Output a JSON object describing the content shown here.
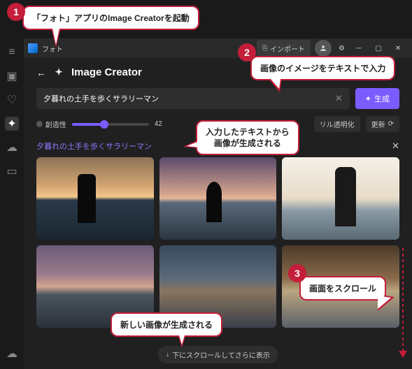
{
  "titlebar": {
    "app_name": "フォト",
    "import_label": "インポート"
  },
  "header": {
    "page_title": "Image Creator"
  },
  "prompt": {
    "value": "夕暮れの土手を歩くサラリーマン",
    "generate_label": "生成"
  },
  "controls": {
    "creativity_label": "創造性",
    "creativity_value": "42",
    "transparency_label": "リル透明化",
    "refresh_label": "更新"
  },
  "results": {
    "section_label": "夕暮れの土手を歩くサラリーマン",
    "scroll_more_label": "下にスクロールしてさらに表示"
  },
  "callouts": {
    "c1_num": "1",
    "c1_text": "「フォト」アプリのImage Creatorを起動",
    "c2_num": "2",
    "c2_text": "画像のイメージをテキストで入力",
    "c2b_text": "入力したテキストから\n画像が生成される",
    "c3_num": "3",
    "c3_text": "画面をスクロール",
    "c3b_text": "新しい画像が生成される"
  }
}
